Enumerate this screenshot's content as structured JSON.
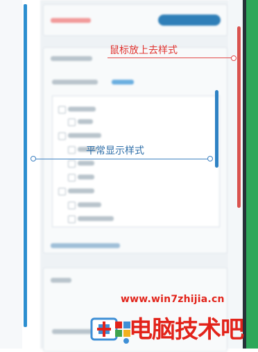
{
  "annotations": {
    "hover_style_label": "鼠标放上去样式",
    "normal_style_label": "平常显示样式"
  },
  "watermark": {
    "url": "www.win7zhijia.cn",
    "brand": "电脑技术吧",
    "logo_icon": "windows-logo-icon"
  },
  "colors": {
    "hover_accent": "#e0332f",
    "normal_accent": "#2e6ea8",
    "normal_scrollbar": "#2e82c4",
    "hover_scrollbar": "#d9534f",
    "right_green_bar": "#2fa75a",
    "watermark_red": "#e2231a"
  }
}
